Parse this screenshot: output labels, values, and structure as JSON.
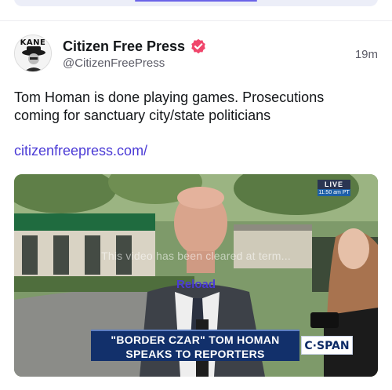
{
  "post": {
    "author": {
      "display_name": "Citizen Free Press",
      "handle": "@CitizenFreePress",
      "verified": true,
      "avatar_label": "KANE"
    },
    "timestamp": "19m",
    "text": "Tom Homan is done playing games. Prosecutions coming for sanctuary city/state politicians",
    "link": "citizenfreepress.com/"
  },
  "video": {
    "live_label": "LIVE",
    "live_time": "11:50 am PT",
    "overlay_message": "This video has been cleared at term...",
    "reload_label": "Reload",
    "chyron_line1": "\"BORDER CZAR\" TOM HOMAN",
    "chyron_line2": "SPEAKS TO REPORTERS",
    "network": "C·SPAN"
  },
  "colors": {
    "accent": "#4b3bd6",
    "verified_badge": "#f0456b",
    "chyron_bg": "#12306b"
  },
  "icons": {
    "verified": "verified-badge-icon",
    "avatar": "avatar-image"
  }
}
